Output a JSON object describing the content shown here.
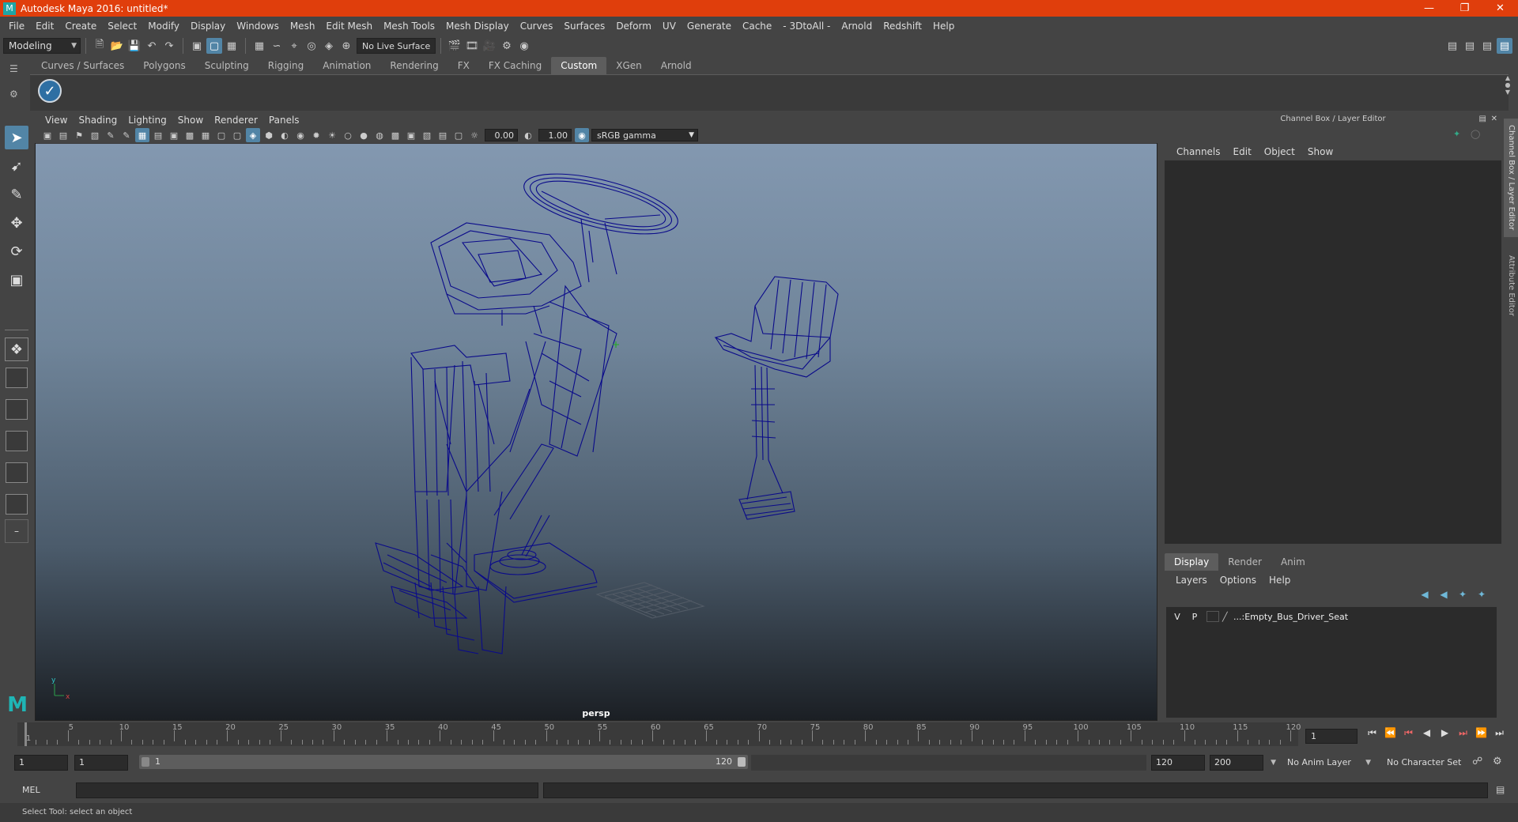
{
  "window": {
    "title": "Autodesk Maya 2016: untitled*",
    "app_icon": "maya-icon"
  },
  "menubar": [
    "File",
    "Edit",
    "Create",
    "Select",
    "Modify",
    "Display",
    "Windows",
    "Mesh",
    "Edit Mesh",
    "Mesh Tools",
    "Mesh Display",
    "Curves",
    "Surfaces",
    "Deform",
    "UV",
    "Generate",
    "Cache",
    "- 3DtoAll -",
    "Arnold",
    "Redshift",
    "Help"
  ],
  "statusline": {
    "mode": "Modeling",
    "live_surface": "No Live Surface"
  },
  "shelf": {
    "tabs": [
      "Curves / Surfaces",
      "Polygons",
      "Sculpting",
      "Rigging",
      "Animation",
      "Rendering",
      "FX",
      "FX Caching",
      "Custom",
      "XGen",
      "Arnold"
    ],
    "active_tab": "Custom"
  },
  "viewport": {
    "menus": [
      "View",
      "Shading",
      "Lighting",
      "Show",
      "Renderer",
      "Panels"
    ],
    "exposure": "0.00",
    "gamma": "1.00",
    "color_space": "sRGB gamma",
    "camera": "persp",
    "axis_y": "y",
    "axis_x": "x",
    "wire_color": "#0a0a8a"
  },
  "channel_box": {
    "title": "Channel Box / Layer Editor",
    "menus": [
      "Channels",
      "Edit",
      "Object",
      "Show"
    ],
    "side_tabs": [
      "Channel Box / Layer Editor",
      "Attribute Editor"
    ]
  },
  "layer_editor": {
    "tabs": [
      "Display",
      "Render",
      "Anim"
    ],
    "active_tab": "Display",
    "menus": [
      "Layers",
      "Options",
      "Help"
    ],
    "layers": [
      {
        "v": "V",
        "p": "P",
        "name": "...:Empty_Bus_Driver_Seat"
      }
    ]
  },
  "timeline": {
    "ticks": [
      1,
      5,
      10,
      15,
      20,
      25,
      30,
      35,
      40,
      45,
      50,
      55,
      60,
      65,
      70,
      75,
      80,
      85,
      90,
      95,
      100,
      105,
      110,
      115,
      120
    ],
    "start_label": "1",
    "current_frame": "1"
  },
  "range": {
    "start": "1",
    "playback_start": "1",
    "slider_start": "1",
    "slider_end": "120",
    "playback_end": "120",
    "end": "200",
    "anim_layer": "No Anim Layer",
    "character_set": "No Character Set"
  },
  "command": {
    "label": "MEL"
  },
  "help_line": "Select Tool: select an object",
  "accent": "#5285a6",
  "title_color": "#e03e0c"
}
